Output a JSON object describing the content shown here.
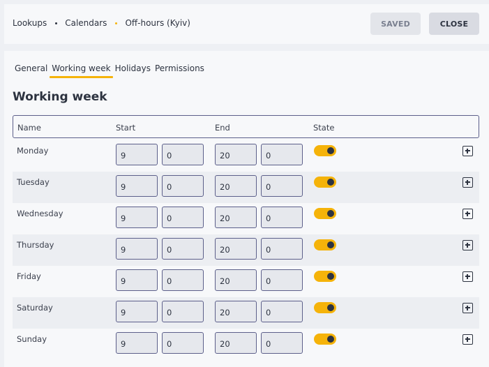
{
  "breadcrumb": [
    "Lookups",
    "Calendars",
    "Off-hours (Kyiv)"
  ],
  "buttons": {
    "saved": "SAVED",
    "close": "CLOSE"
  },
  "tabs": [
    {
      "label": "General",
      "active": false
    },
    {
      "label": "Working week",
      "active": true
    },
    {
      "label": "Holidays",
      "active": false
    },
    {
      "label": "Permissions",
      "active": false
    }
  ],
  "section_title": "Working week",
  "columns": {
    "name": "Name",
    "start": "Start",
    "end": "End",
    "state": "State"
  },
  "days": [
    {
      "name": "Monday",
      "start_h": "9",
      "start_m": "0",
      "end_h": "20",
      "end_m": "0",
      "state": true
    },
    {
      "name": "Tuesday",
      "start_h": "9",
      "start_m": "0",
      "end_h": "20",
      "end_m": "0",
      "state": true
    },
    {
      "name": "Wednesday",
      "start_h": "9",
      "start_m": "0",
      "end_h": "20",
      "end_m": "0",
      "state": true
    },
    {
      "name": "Thursday",
      "start_h": "9",
      "start_m": "0",
      "end_h": "20",
      "end_m": "0",
      "state": true
    },
    {
      "name": "Friday",
      "start_h": "9",
      "start_m": "0",
      "end_h": "20",
      "end_m": "0",
      "state": true
    },
    {
      "name": "Saturday",
      "start_h": "9",
      "start_m": "0",
      "end_h": "20",
      "end_m": "0",
      "state": true
    },
    {
      "name": "Sunday",
      "start_h": "9",
      "start_m": "0",
      "end_h": "20",
      "end_m": "0",
      "state": true
    }
  ],
  "colors": {
    "accent": "#f5b30a",
    "border": "#5c5f8a",
    "text": "#2d3340"
  }
}
